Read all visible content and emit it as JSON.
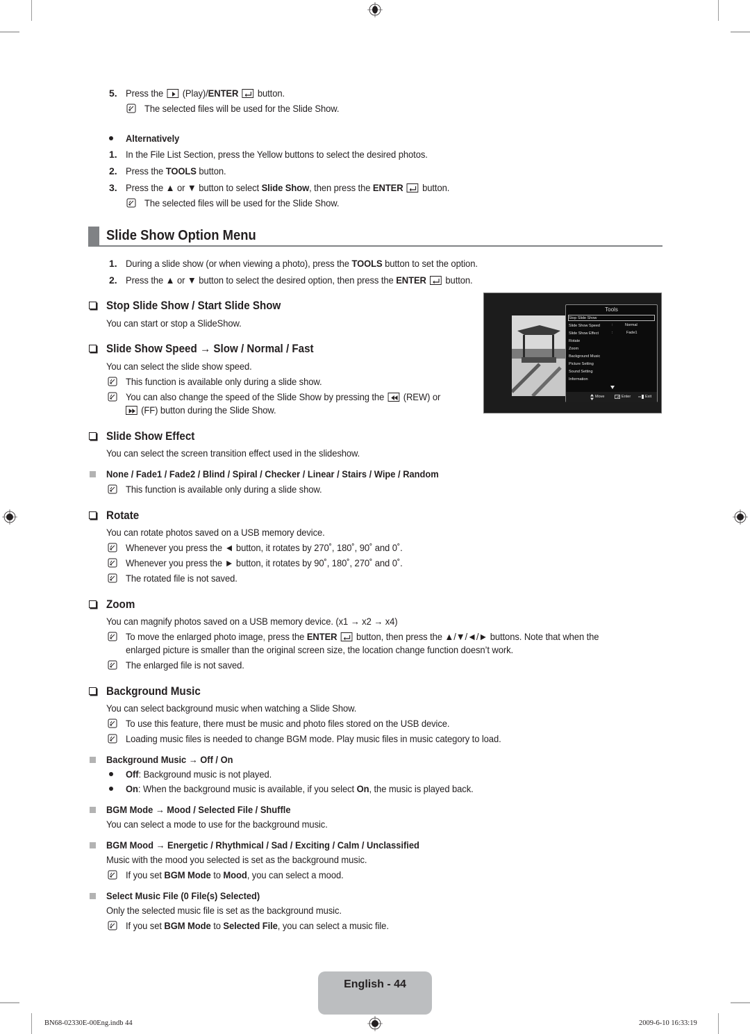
{
  "top_steps": {
    "step5": {
      "num": "5.",
      "pre": "Press the",
      "mid": "(Play)/",
      "enter": "ENTER",
      "post": "button."
    },
    "step5_note": "The selected files will be used for the Slide Show.",
    "alt_label": "Alternatively",
    "alt1": {
      "num": "1.",
      "text": "In the File List Section, press the Yellow buttons to select the desired photos."
    },
    "alt2": {
      "num": "2.",
      "pre": "Press the ",
      "bold": "TOOLS",
      "post": " button."
    },
    "alt3": {
      "num": "3.",
      "pre": "Press the ▲ or ▼ button to select ",
      "bold1": "Slide Show",
      "mid": ", then press the ",
      "enter": "ENTER",
      "post": "button."
    },
    "alt3_note": "The selected files will be used for the Slide Show."
  },
  "section": {
    "title": "Slide Show Option Menu",
    "step1": {
      "num": "1.",
      "pre": "During a slide show (or when viewing a photo), press the ",
      "bold": "TOOLS",
      "post": " button to set the option."
    },
    "step2": {
      "num": "2.",
      "pre": "Press the ▲ or ▼ button to select the desired option, then press the ",
      "enter": "ENTER",
      "post": "button."
    }
  },
  "stop_slide": {
    "heading": "Stop Slide Show / Start Slide Show",
    "desc": "You can start or stop a SlideShow."
  },
  "speed": {
    "heading": "Slide Show Speed → Slow / Normal / Fast",
    "desc": "You can select the slide show speed.",
    "note1": "This function is available only during a slide show.",
    "note2_a": "You can also change the speed of the Slide Show by pressing the",
    "note2_b": "(REW) or",
    "note2_c": "(FF) button during the Slide Show."
  },
  "effect": {
    "heading": "Slide Show Effect",
    "desc": "You can select the screen transition effect used in the slideshow.",
    "options": "None / Fade1 / Fade2 / Blind / Spiral / Checker / Linear / Stairs / Wipe / Random",
    "note": "This function is available only during a slide show."
  },
  "rotate": {
    "heading": "Rotate",
    "desc": "You can rotate photos saved on a USB memory device.",
    "note1": "Whenever you press the ◄ button, it rotates by 270˚, 180˚, 90˚ and 0˚.",
    "note2": "Whenever you press the ► button, it rotates by 90˚, 180˚, 270˚ and 0˚.",
    "note3": "The rotated file is not saved."
  },
  "zoom": {
    "heading": "Zoom",
    "desc": "You can magnify photos saved on a USB memory device. (x1 → x2 → x4)",
    "note1_a": "To move the enlarged photo image, press the ",
    "note1_enter": "ENTER",
    "note1_b": "button, then press the ▲/▼/◄/► buttons. Note that when the",
    "note1_c": "enlarged picture is smaller than the original screen size, the location change function doesn’t work.",
    "note2": "The enlarged file is not saved."
  },
  "bgm": {
    "heading": "Background Music",
    "desc": "You can select background music when watching a Slide Show.",
    "note1": "To use this feature, there must be music and photo files stored on the USB device.",
    "note2": "Loading music files is needed to change BGM mode. Play music files in music category to load.",
    "onoff_heading": "Background Music → Off / On",
    "off_bold": "Off",
    "off_text": ": Background music is not played.",
    "on_bold": "On",
    "on_text_a": ": When the background music is available, if you select ",
    "on_bold2": "On",
    "on_text_b": ", the music is played back.",
    "mode_heading": "BGM Mode → Mood / Selected File / Shuffle",
    "mode_desc": "You can select a mode to use for the background music.",
    "mood_heading": "BGM Mood → Energetic / Rhythmical / Sad / Exciting / Calm / Unclassified",
    "mood_desc": "Music with the mood you selected is set as the background music.",
    "mood_note_a": "If you set ",
    "mood_note_b1": "BGM Mode",
    "mood_note_c": " to ",
    "mood_note_b2": "Mood",
    "mood_note_d": ", you can select a mood.",
    "file_heading": "Select Music File (0 File(s) Selected)",
    "file_desc": "Only the selected music file is set as the background music.",
    "file_note_a": "If you set ",
    "file_note_b1": "BGM Mode",
    "file_note_c": " to ",
    "file_note_b2": "Selected File",
    "file_note_d": ", you can select a music file."
  },
  "tv_menu": {
    "title": "Tools",
    "items": [
      {
        "label": "Stop Slide Show",
        "value": ""
      },
      {
        "label": "Slide Show Speed",
        "value": "Normal"
      },
      {
        "label": "Slide Show Effect",
        "value": "Fade1"
      },
      {
        "label": "Rotate",
        "value": ""
      },
      {
        "label": "Zoom",
        "value": ""
      },
      {
        "label": "Background Music",
        "value": ""
      },
      {
        "label": "Picture Setting",
        "value": ""
      },
      {
        "label": "Sound Setting",
        "value": ""
      },
      {
        "label": "Information",
        "value": ""
      }
    ],
    "separator": ":",
    "footer": {
      "move": "Move",
      "enter": "Enter",
      "exit": "Exit"
    }
  },
  "page_label": "English - 44",
  "footer": {
    "file": "BN68-02330E-00Eng.indb   44",
    "timestamp": "2009-6-10   16:33:19"
  }
}
